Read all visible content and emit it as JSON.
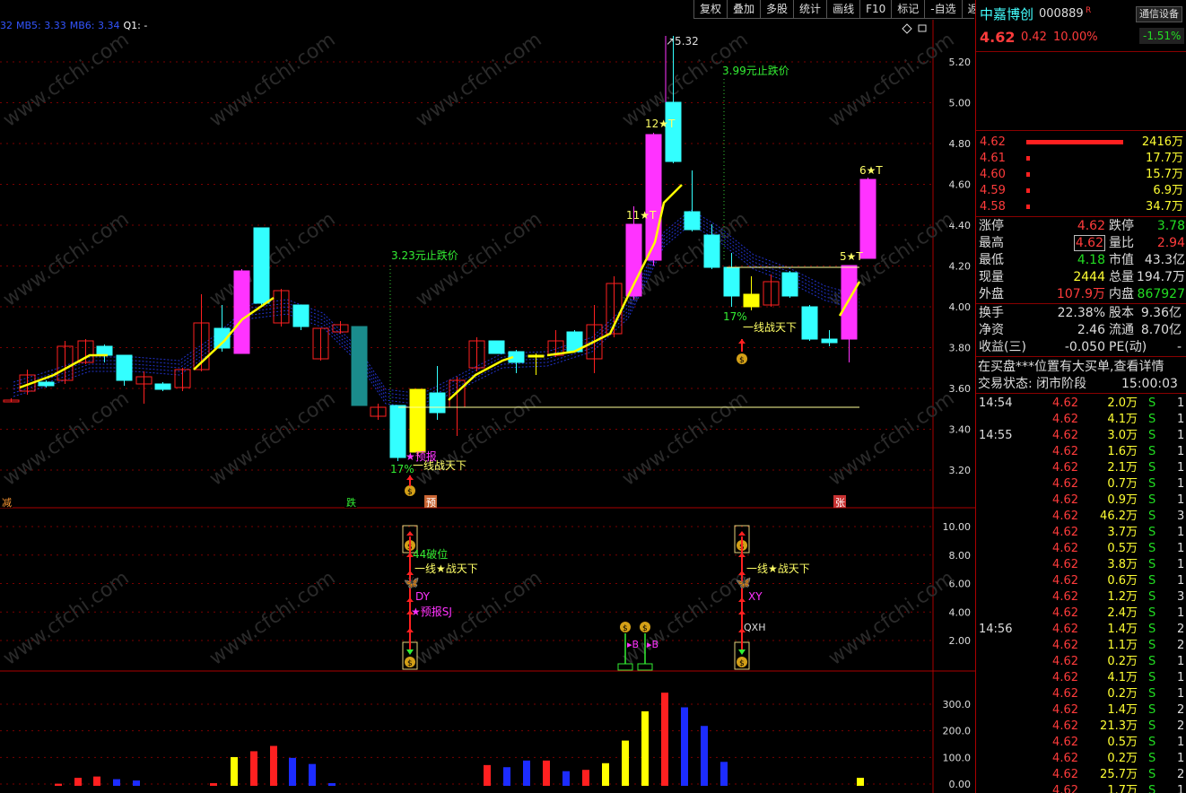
{
  "toolbar": [
    "复权",
    "叠加",
    "多股",
    "统计",
    "画线",
    "F10",
    "标记",
    "-自选",
    "返回"
  ],
  "ma_legend": [
    {
      "text": "32",
      "color": "#3355ff"
    },
    {
      "text": "MB5: 3.33",
      "color": "#3355ff"
    },
    {
      "text": "MB6: 3.34",
      "color": "#3355ff"
    },
    {
      "text": "Q1: -",
      "color": "#ffffff"
    }
  ],
  "stock": {
    "name": "中嘉博创",
    "code": "000889",
    "flag": "R",
    "price": "4.62",
    "change": "0.42",
    "pct": "10.00%",
    "badge": "通信设备",
    "badge_pct": "-1.51%"
  },
  "order_book": [
    {
      "price": "4.62",
      "vol": "2416万",
      "bar": 1.0
    },
    {
      "price": "4.61",
      "vol": "17.7万",
      "bar": 0.01
    },
    {
      "price": "4.60",
      "vol": "15.7万",
      "bar": 0.01
    },
    {
      "price": "4.59",
      "vol": "6.9万",
      "bar": 0.01
    },
    {
      "price": "4.58",
      "vol": "34.7万",
      "bar": 0.01
    }
  ],
  "quote": [
    {
      "k1": "涨停",
      "v1": "4.62",
      "c1": "red",
      "k2": "跌停",
      "v2": "3.78",
      "c2": "green"
    },
    {
      "k1": "最高",
      "v1": "4.62",
      "c1": "red",
      "k2": "量比",
      "v2": "2.94",
      "c2": "red"
    },
    {
      "k1": "最低",
      "v1": "4.18",
      "c1": "green",
      "k2": "市值",
      "v2": "43.3亿",
      "c2": "white"
    },
    {
      "k1": "现量",
      "v1": "2444",
      "c1": "yellow",
      "k2": "总量",
      "v2": "194.7万",
      "c2": "white"
    },
    {
      "k1": "外盘",
      "v1": "107.9万",
      "c1": "red",
      "k2": "内盘",
      "v2": "867927",
      "c2": "green"
    }
  ],
  "quote2": [
    {
      "k1": "换手",
      "v1": "22.38%",
      "k2": "股本",
      "v2": "9.36亿"
    },
    {
      "k1": "净资",
      "v1": "2.46",
      "k2": "流通",
      "v2": "8.70亿"
    },
    {
      "k1": "收益(三)",
      "v1": "-0.050",
      "k2": "PE(动)",
      "v2": "-"
    }
  ],
  "notice": "在买盘***位置有大买单,查看详情",
  "trade_state": {
    "label": "交易状态: 闭市阶段",
    "time": "15:00:03"
  },
  "ticks": [
    {
      "t": "14:54",
      "p": "4.62",
      "v": "2.0万",
      "s": "S",
      "n": "1"
    },
    {
      "t": "",
      "p": "4.62",
      "v": "4.1万",
      "s": "S",
      "n": "1"
    },
    {
      "t": "14:55",
      "p": "4.62",
      "v": "3.0万",
      "s": "S",
      "n": "1"
    },
    {
      "t": "",
      "p": "4.62",
      "v": "1.6万",
      "s": "S",
      "n": "1"
    },
    {
      "t": "",
      "p": "4.62",
      "v": "2.1万",
      "s": "S",
      "n": "1"
    },
    {
      "t": "",
      "p": "4.62",
      "v": "0.7万",
      "s": "S",
      "n": "1"
    },
    {
      "t": "",
      "p": "4.62",
      "v": "0.9万",
      "s": "S",
      "n": "1"
    },
    {
      "t": "",
      "p": "4.62",
      "v": "46.2万",
      "s": "S",
      "n": "3"
    },
    {
      "t": "",
      "p": "4.62",
      "v": "3.7万",
      "s": "S",
      "n": "1"
    },
    {
      "t": "",
      "p": "4.62",
      "v": "0.5万",
      "s": "S",
      "n": "1"
    },
    {
      "t": "",
      "p": "4.62",
      "v": "3.8万",
      "s": "S",
      "n": "1"
    },
    {
      "t": "",
      "p": "4.62",
      "v": "0.6万",
      "s": "S",
      "n": "1"
    },
    {
      "t": "",
      "p": "4.62",
      "v": "1.2万",
      "s": "S",
      "n": "3"
    },
    {
      "t": "",
      "p": "4.62",
      "v": "2.4万",
      "s": "S",
      "n": "1"
    },
    {
      "t": "14:56",
      "p": "4.62",
      "v": "1.4万",
      "s": "S",
      "n": "2"
    },
    {
      "t": "",
      "p": "4.62",
      "v": "1.1万",
      "s": "S",
      "n": "2"
    },
    {
      "t": "",
      "p": "4.62",
      "v": "0.2万",
      "s": "S",
      "n": "1"
    },
    {
      "t": "",
      "p": "4.62",
      "v": "4.1万",
      "s": "S",
      "n": "1"
    },
    {
      "t": "",
      "p": "4.62",
      "v": "0.2万",
      "s": "S",
      "n": "1"
    },
    {
      "t": "",
      "p": "4.62",
      "v": "1.4万",
      "s": "S",
      "n": "2"
    },
    {
      "t": "",
      "p": "4.62",
      "v": "21.3万",
      "s": "S",
      "n": "2"
    },
    {
      "t": "",
      "p": "4.62",
      "v": "0.5万",
      "s": "S",
      "n": "1"
    },
    {
      "t": "",
      "p": "4.62",
      "v": "0.2万",
      "s": "S",
      "n": "1"
    },
    {
      "t": "",
      "p": "4.62",
      "v": "25.7万",
      "s": "S",
      "n": "2"
    },
    {
      "t": "",
      "p": "4.62",
      "v": "1.7万",
      "s": "S",
      "n": "1"
    }
  ],
  "main_axis": [
    "5.20",
    "5.00",
    "4.80",
    "4.60",
    "4.40",
    "4.20",
    "4.00",
    "3.80",
    "3.60",
    "3.40",
    "3.20"
  ],
  "ind_axis": [
    "10.00",
    "8.00",
    "6.00",
    "4.00",
    "2.00"
  ],
  "vol_axis": [
    "300.0",
    "200.0",
    "100.0",
    "0.00"
  ],
  "annotations": {
    "high_label": "5.32",
    "stop1": "3.23元止跌价",
    "stop2": "3.99元止跌价",
    "pct1": "17%",
    "pct2": "17%",
    "yixian": "一线战天下",
    "yubao": "预报",
    "t11": "11★T",
    "t12": "12★T",
    "t6": "6★T",
    "t5": "5★T",
    "b_die": "跌",
    "b_yu": "预",
    "b_zhang": "张",
    "b_left": "减",
    "ind_po": "44破位",
    "ind_yx": "一线★战天下",
    "ind_dy": "DY",
    "ind_yb": "预报SJ",
    "ind_xy": "XY",
    "ind_qxh": "QXH",
    "ind_b": "B"
  },
  "colors": {
    "up": "#ff33ff",
    "down": "#33ffff",
    "yellow": "#ffff00",
    "red": "#ff2020",
    "blue": "#1c2cff"
  }
}
